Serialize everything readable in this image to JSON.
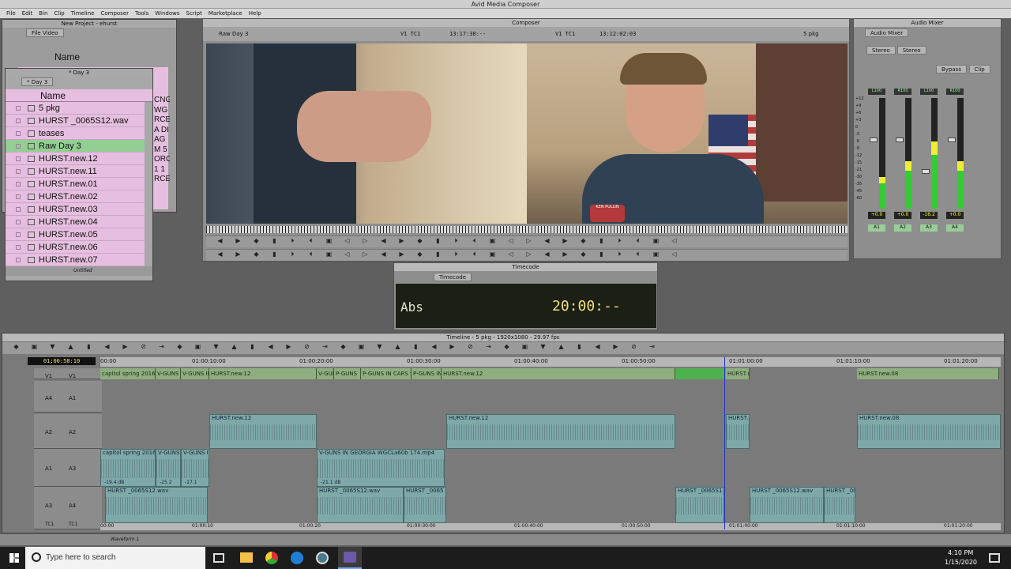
{
  "app": {
    "title": "Avid Media Composer",
    "menu": [
      "File",
      "Edit",
      "Bin",
      "Clip",
      "Timeline",
      "Composer",
      "Tools",
      "Windows",
      "Script",
      "Marketplace",
      "Help"
    ]
  },
  "project": {
    "title": "New Project - ehurst",
    "tab": "File Video",
    "col": "Name"
  },
  "bin": {
    "title": "* Day 3",
    "tab": "* Day 3",
    "col_name": "Name",
    "items": [
      "5 pkg",
      "HURST _0065S12.wav",
      "teases",
      "Raw Day 3",
      "HURST.new.12",
      "HURST.new.11",
      "HURST.new.01",
      "HURST.new.02",
      "HURST.new.03",
      "HURST.new.04",
      "HURST.new.05",
      "HURST.new.06",
      "HURST.new.07"
    ],
    "footer": "Untitled",
    "side": [
      "CNG",
      "WG",
      "RCE",
      "A DI",
      "AG",
      "M 5",
      "ORC",
      "1 1",
      "RCE"
    ]
  },
  "composer": {
    "title": "Composer",
    "source": "Raw Day 3",
    "src_track": "V1 TC1",
    "src_tc": "13:17:30:--",
    "rec_track": "V1 TC1",
    "rec_tc": "13:12:02:03",
    "seq": "5 pkg",
    "lower_third": "KEN PULLIN"
  },
  "mixer": {
    "title": "Audio Mixer",
    "tab": "Audio Mixer",
    "modes": [
      "Stereo",
      "Stereo"
    ],
    "bypass": "Bypass",
    "clip": "Clip",
    "channels": [
      {
        "pan": "L100",
        "value": "+0.0",
        "label": "A1"
      },
      {
        "pan": "R100",
        "value": "+0.0",
        "label": "A2"
      },
      {
        "pan": "L100",
        "value": "-16.2",
        "label": "A3"
      },
      {
        "pan": "R100",
        "value": "+0.0",
        "label": "A4"
      }
    ],
    "scale": [
      "+12",
      "+9",
      "+6",
      "+3",
      "0",
      "-3",
      "-6",
      "-9",
      "-12",
      "-15",
      "-21",
      "-30",
      "-35",
      "-45",
      "-60"
    ]
  },
  "timecode": {
    "title": "Timecode",
    "tab": "Timecode",
    "mode": "Abs",
    "value": "20:00:--"
  },
  "timeline": {
    "title": "Timeline - 5 pkg - 1920x1080 - 29.97 fps",
    "position": "01:00:58:10",
    "ruler": [
      "00:00",
      "01:00:10:00",
      "01:00:20:00",
      "01:00:30:00",
      "01:00:40:00",
      "01:00:50:00",
      "01:01:00:00",
      "01:01:10:00",
      "01:01:20:00"
    ],
    "ruler_bottom": [
      "00:00",
      "01:00:10",
      "01:00:20",
      "01:00:30:00",
      "01:00:40:00",
      "01:00:50:00",
      "01:01:00:00",
      "01:01:10:00",
      "01:01:20:00"
    ],
    "tracks": [
      {
        "src": "V1",
        "rec": "V1"
      },
      {
        "src": "A4",
        "rec": "A1"
      },
      {
        "src": "A2",
        "rec": "A2"
      },
      {
        "src": "A1",
        "rec": "A3"
      },
      {
        "src": "A3",
        "rec": "A4"
      },
      {
        "src": "TC1",
        "rec": "TC1"
      }
    ],
    "v1_clips": [
      "capitol spring 2016",
      "V-GUNS",
      "V-GUNS IN",
      "HURST.new.12",
      "V-GUN",
      "P-GUNS",
      "P-GUNS IN CARS SP",
      "P-GUNS IN",
      "HURST.new.12",
      "HURST.n",
      "HURST.new.08"
    ],
    "a2_clips": [
      "HURST.new.12",
      "HURST.new.12",
      "HURST.n",
      "HURST.new.08"
    ],
    "a3_clips": [
      "capitol spring 2016",
      "V-GUNS",
      "V-GUNS IN",
      "V-GUNS IN GEORGIA WGCLa60b 174.mp4"
    ],
    "a3_levels": [
      "-19.4 dB",
      "-25.2",
      "-17.1",
      "-21.1 dB"
    ],
    "a4_clips": [
      "HURST _0065S12.wav",
      "HURST _0065S12.wav",
      "HURST _0065",
      "HURST _0065S1",
      "HURST _0065S12.wav",
      "HURST _00"
    ],
    "footer": "Waveform 1"
  },
  "taskbar": {
    "search": "Type here to search",
    "time": "4:10 PM",
    "date": "1/15/2020"
  },
  "colors": {
    "accent_green": "#4fb04f",
    "bin_pink": "#e6bfe0",
    "clip_teal": "#7fa9a9",
    "clip_green": "#8fae7f"
  }
}
